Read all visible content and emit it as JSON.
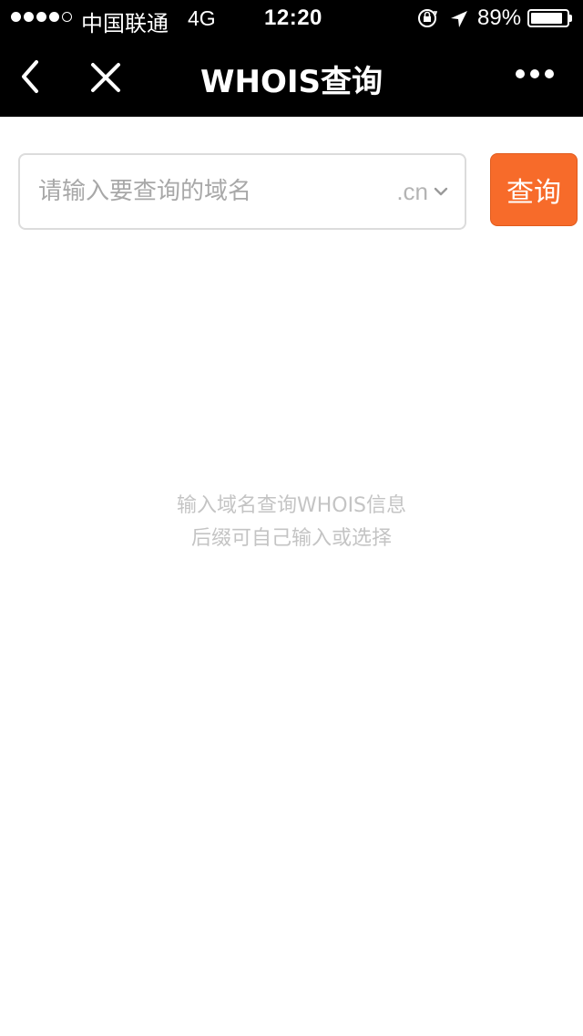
{
  "status_bar": {
    "carrier": "中国联通",
    "network": "4G",
    "time": "12:20",
    "battery_percent": "89%",
    "battery_level": 0.89,
    "signal_bars_filled": 4,
    "signal_bars_total": 5,
    "icons": [
      "orientation-lock-icon",
      "location-arrow-icon",
      "battery-icon"
    ]
  },
  "nav": {
    "title": "WHOIS查询",
    "icons": [
      "back-icon",
      "close-icon",
      "more-icon"
    ]
  },
  "search": {
    "placeholder": "请输入要查询的域名",
    "value": "",
    "suffix": ".cn",
    "button_label": "查询"
  },
  "hint": {
    "line1": "输入域名查询WHOIS信息",
    "line2": "后缀可自己输入或选择"
  },
  "colors": {
    "accent": "#f76b2a",
    "nav_background": "#000000",
    "hint_text": "#c4c4c4",
    "border": "#dcdcdc"
  }
}
